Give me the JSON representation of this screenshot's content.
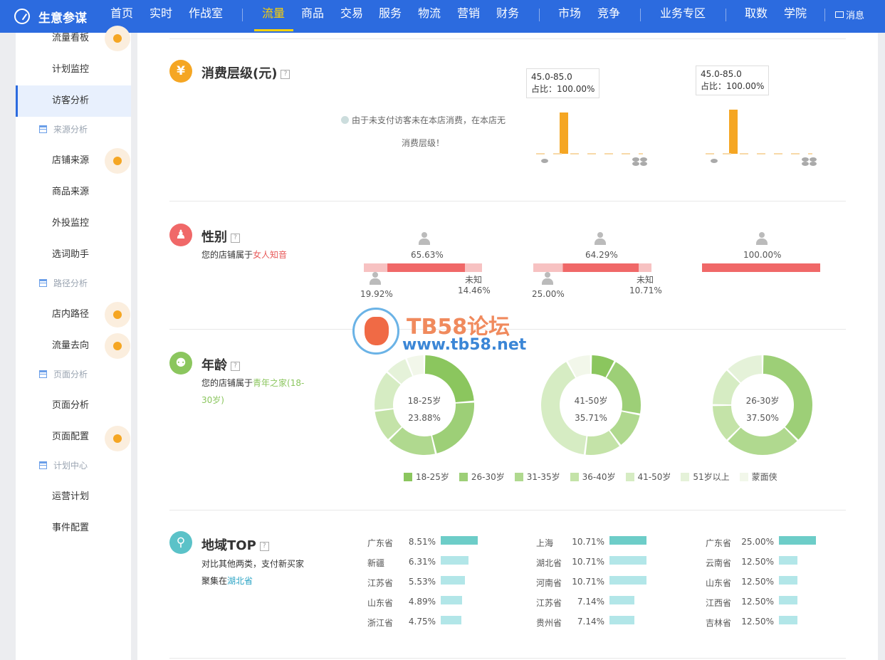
{
  "topbar": {
    "brand": "生意参谋",
    "nav": [
      "首页",
      "实时",
      "作战室",
      "流量",
      "商品",
      "交易",
      "服务",
      "物流",
      "营销",
      "财务",
      "市场",
      "竞争",
      "业务专区",
      "取数",
      "学院"
    ],
    "active": "流量",
    "message": "消息"
  },
  "sidebar": {
    "items": [
      {
        "label": "流量看板",
        "type": "item"
      },
      {
        "label": "计划监控",
        "type": "item"
      },
      {
        "label": "访客分析",
        "type": "item",
        "active": true
      },
      {
        "label": "来源分析",
        "type": "group"
      },
      {
        "label": "店铺来源",
        "type": "item"
      },
      {
        "label": "商品来源",
        "type": "item"
      },
      {
        "label": "外投监控",
        "type": "item"
      },
      {
        "label": "选词助手",
        "type": "item"
      },
      {
        "label": "路径分析",
        "type": "group"
      },
      {
        "label": "店内路径",
        "type": "item"
      },
      {
        "label": "流量去向",
        "type": "item"
      },
      {
        "label": "页面分析",
        "type": "group"
      },
      {
        "label": "页面分析",
        "type": "item"
      },
      {
        "label": "页面配置",
        "type": "item"
      },
      {
        "label": "计划中心",
        "type": "group"
      },
      {
        "label": "运营计划",
        "type": "item"
      },
      {
        "label": "事件配置",
        "type": "item"
      }
    ]
  },
  "consumption": {
    "title": "消费层级(元)",
    "note_line1": "由于未支付访客未在本店消费，在本店无",
    "note_line2": "消费层级！",
    "col2_tip_range": "45.0-85.0",
    "col2_tip_share": "占比：100.00%",
    "col3_tip_range": "45.0-85.0",
    "col3_tip_share": "占比：100.00%"
  },
  "gender": {
    "title": "性别",
    "sub_prefix": "您的店铺属于",
    "sub_highlight": "女人知音",
    "unknown_label": "未知",
    "cols": [
      {
        "female": "65.63%",
        "male": "19.92%",
        "unknown": "14.46%",
        "female_frac": 0.6563,
        "male_frac": 0.1992
      },
      {
        "female": "64.29%",
        "male": "25.00%",
        "unknown": "10.71%",
        "female_frac": 0.6429,
        "male_frac": 0.25
      },
      {
        "female": "100.00%",
        "female_frac": 1.0
      }
    ]
  },
  "age": {
    "title": "年龄",
    "sub_prefix": "您的店铺属于",
    "sub_highlight_line1": "青年之家(18-",
    "sub_highlight_line2": "30岁)",
    "donuts": [
      {
        "label": "18-25岁",
        "value": "23.88%",
        "shares": [
          0.2388,
          0.2239,
          0.1642,
          0.1045,
          0.1343,
          0.0746,
          0.0597
        ]
      },
      {
        "label": "41-50岁",
        "value": "35.71%",
        "shares": [
          0.0714,
          0.1786,
          0.1071,
          0.1071,
          0.3571,
          0,
          0.0714
        ]
      },
      {
        "label": "26-30岁",
        "value": "37.50%",
        "shares": [
          0.0,
          0.375,
          0.25,
          0.125,
          0.125,
          0.125,
          0.0
        ]
      }
    ],
    "legend": [
      "18-25岁",
      "26-30岁",
      "31-35岁",
      "36-40岁",
      "41-50岁",
      "51岁以上",
      "蒙面侠"
    ],
    "legend_colors": [
      "#8bc65e",
      "#9dcf77",
      "#b0d98f",
      "#c4e3a8",
      "#d6ecc3",
      "#e5f2d9",
      "#f2f7ea"
    ]
  },
  "region": {
    "title": "地域TOP",
    "sub_line1": "对比其他两类，支付新买家",
    "sub_prefix": "聚集在",
    "sub_highlight": "湖北省",
    "cols": [
      [
        {
          "name": "广东省",
          "value": "8.51%",
          "frac": 0.0851
        },
        {
          "name": "新疆",
          "value": "6.31%",
          "frac": 0.0631
        },
        {
          "name": "江苏省",
          "value": "5.53%",
          "frac": 0.0553
        },
        {
          "name": "山东省",
          "value": "4.89%",
          "frac": 0.0489
        },
        {
          "name": "浙江省",
          "value": "4.75%",
          "frac": 0.0475
        }
      ],
      [
        {
          "name": "上海",
          "value": "10.71%",
          "frac": 0.1071
        },
        {
          "name": "湖北省",
          "value": "10.71%",
          "frac": 0.1071
        },
        {
          "name": "河南省",
          "value": "10.71%",
          "frac": 0.1071
        },
        {
          "name": "江苏省",
          "value": "7.14%",
          "frac": 0.0714
        },
        {
          "name": "贵州省",
          "value": "7.14%",
          "frac": 0.0714
        }
      ],
      [
        {
          "name": "广东省",
          "value": "25.00%",
          "frac": 0.25
        },
        {
          "name": "云南省",
          "value": "12.50%",
          "frac": 0.125
        },
        {
          "name": "山东省",
          "value": "12.50%",
          "frac": 0.125
        },
        {
          "name": "江西省",
          "value": "12.50%",
          "frac": 0.125
        },
        {
          "name": "吉林省",
          "value": "12.50%",
          "frac": 0.125
        }
      ]
    ]
  },
  "watermark": {
    "title": "TB58论坛",
    "url": "www.tb58.net"
  }
}
